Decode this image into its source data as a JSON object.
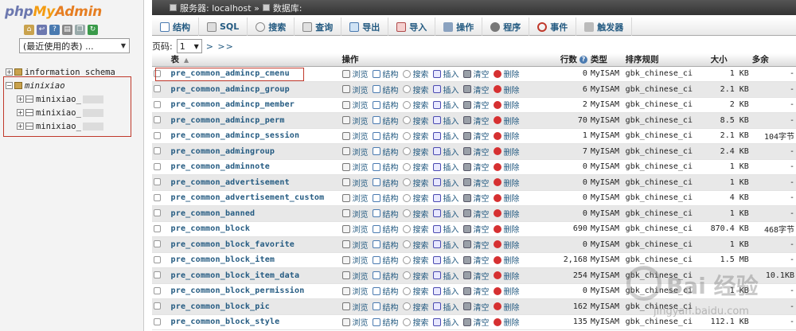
{
  "app": {
    "logo_php": "php",
    "logo_my": "My",
    "logo_admin": "Admin"
  },
  "nav": {
    "recent_label": "(最近使用的表) ...",
    "tree": [
      {
        "name": "information_schema",
        "expand": "+"
      },
      {
        "name": "minixiao",
        "expand": "−"
      },
      {
        "name": "minixiao_",
        "expand": "+"
      },
      {
        "name": "minixiao_",
        "expand": "+"
      },
      {
        "name": "minixiao_",
        "expand": "+"
      }
    ]
  },
  "breadcrumb": {
    "server": "服务器: localhost »",
    "database": "数据库:"
  },
  "tabs": [
    "结构",
    "SQL",
    "搜索",
    "查询",
    "导出",
    "导入",
    "操作",
    "程序",
    "事件",
    "触发器"
  ],
  "pager": {
    "label": "页码:",
    "value": "1",
    "next": "> >>"
  },
  "columns": {
    "table": "表",
    "ops": "操作",
    "rows": "行数",
    "type": "类型",
    "collation": "排序规则",
    "size": "大小",
    "overhead": "多余"
  },
  "actions": {
    "browse": "浏览",
    "structure": "结构",
    "search": "搜索",
    "insert": "插入",
    "empty": "清空",
    "drop": "删除"
  },
  "rows": [
    {
      "name": "pre_common_admincp_cmenu",
      "rows": "0",
      "type": "MyISAM",
      "collation": "gbk_chinese_ci",
      "size": "1 KB",
      "overhead": "-"
    },
    {
      "name": "pre_common_admincp_group",
      "rows": "6",
      "type": "MyISAM",
      "collation": "gbk_chinese_ci",
      "size": "2.1 KB",
      "overhead": "-"
    },
    {
      "name": "pre_common_admincp_member",
      "rows": "2",
      "type": "MyISAM",
      "collation": "gbk_chinese_ci",
      "size": "2 KB",
      "overhead": "-"
    },
    {
      "name": "pre_common_admincp_perm",
      "rows": "70",
      "type": "MyISAM",
      "collation": "gbk_chinese_ci",
      "size": "8.5 KB",
      "overhead": "-"
    },
    {
      "name": "pre_common_admincp_session",
      "rows": "1",
      "type": "MyISAM",
      "collation": "gbk_chinese_ci",
      "size": "2.1 KB",
      "overhead": "104字节"
    },
    {
      "name": "pre_common_admingroup",
      "rows": "7",
      "type": "MyISAM",
      "collation": "gbk_chinese_ci",
      "size": "2.4 KB",
      "overhead": "-"
    },
    {
      "name": "pre_common_adminnote",
      "rows": "0",
      "type": "MyISAM",
      "collation": "gbk_chinese_ci",
      "size": "1 KB",
      "overhead": "-"
    },
    {
      "name": "pre_common_advertisement",
      "rows": "0",
      "type": "MyISAM",
      "collation": "gbk_chinese_ci",
      "size": "1 KB",
      "overhead": "-"
    },
    {
      "name": "pre_common_advertisement_custom",
      "rows": "0",
      "type": "MyISAM",
      "collation": "gbk_chinese_ci",
      "size": "4 KB",
      "overhead": "-"
    },
    {
      "name": "pre_common_banned",
      "rows": "0",
      "type": "MyISAM",
      "collation": "gbk_chinese_ci",
      "size": "1 KB",
      "overhead": "-"
    },
    {
      "name": "pre_common_block",
      "rows": "690",
      "type": "MyISAM",
      "collation": "gbk_chinese_ci",
      "size": "870.4 KB",
      "overhead": "468字节"
    },
    {
      "name": "pre_common_block_favorite",
      "rows": "0",
      "type": "MyISAM",
      "collation": "gbk_chinese_ci",
      "size": "1 KB",
      "overhead": "-"
    },
    {
      "name": "pre_common_block_item",
      "rows": "2,168",
      "type": "MyISAM",
      "collation": "gbk_chinese_ci",
      "size": "1.5 MB",
      "overhead": "-"
    },
    {
      "name": "pre_common_block_item_data",
      "rows": "254",
      "type": "MyISAM",
      "collation": "gbk_chinese_ci",
      "size": "",
      "overhead": "10.1KB"
    },
    {
      "name": "pre_common_block_permission",
      "rows": "0",
      "type": "MyISAM",
      "collation": "gbk_chinese_ci",
      "size": "1 KB",
      "overhead": "-"
    },
    {
      "name": "pre_common_block_pic",
      "rows": "162",
      "type": "MyISAM",
      "collation": "gbk_chinese_ci",
      "size": "",
      "overhead": "-"
    },
    {
      "name": "pre_common_block_style",
      "rows": "135",
      "type": "MyISAM",
      "collation": "gbk_chinese_ci",
      "size": "112.1 KB",
      "overhead": "-"
    }
  ],
  "watermark": {
    "brand": "Bai 经验",
    "sub": "jingyan.baidu.com"
  },
  "colors": {
    "link": "#235a81",
    "highlight": "#c0392b"
  }
}
